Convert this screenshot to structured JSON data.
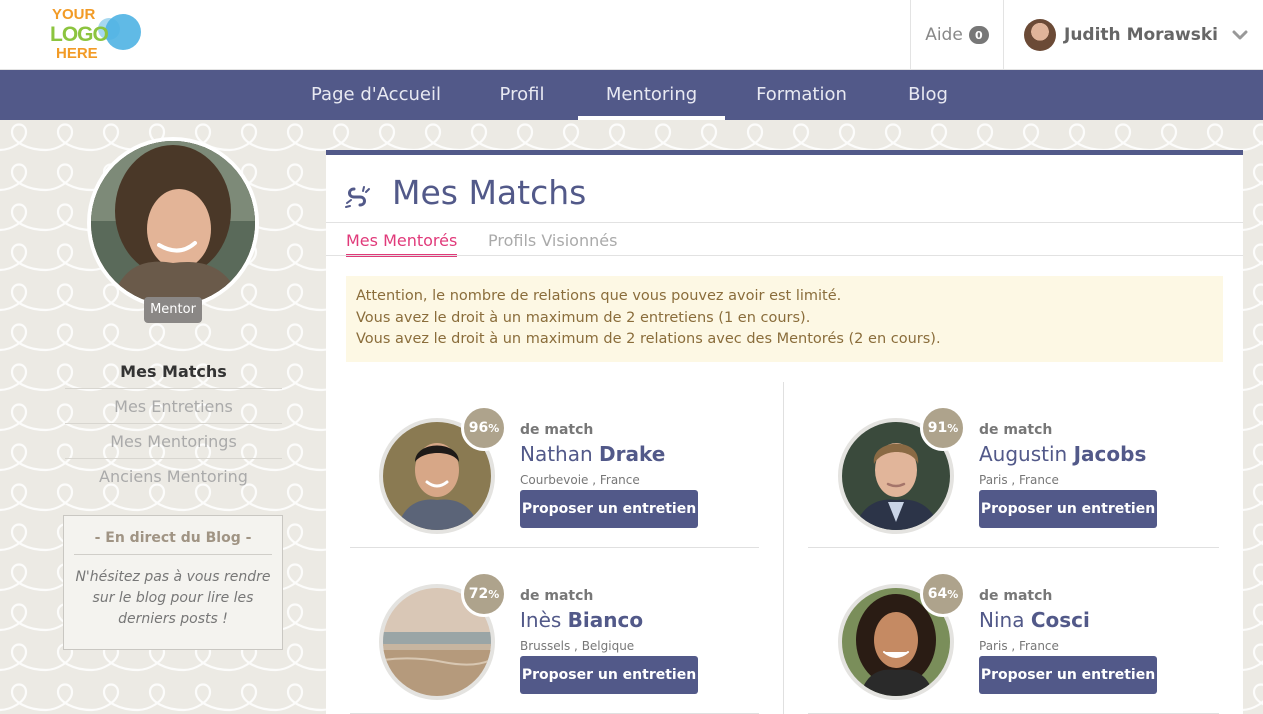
{
  "logo": {
    "line1": "YOUR",
    "line2": "LOGO",
    "line3": "HERE"
  },
  "header": {
    "help_label": "Aide",
    "help_count": "0",
    "user_name": "Judith Morawski"
  },
  "nav": {
    "items": [
      {
        "label": "Page d'Accueil"
      },
      {
        "label": "Profil"
      },
      {
        "label": "Mentoring"
      },
      {
        "label": "Formation"
      },
      {
        "label": "Blog"
      }
    ],
    "active": "Mentoring"
  },
  "sidebar": {
    "role_badge": "Mentor",
    "menu": [
      {
        "label": "Mes Matchs"
      },
      {
        "label": "Mes Entretiens"
      },
      {
        "label": "Mes Mentorings"
      },
      {
        "label": "Anciens Mentoring"
      }
    ],
    "blog": {
      "title": "- En direct du Blog -",
      "text": "N'hésitez pas à vous rendre sur le blog pour lire les derniers posts !"
    }
  },
  "main": {
    "title": "Mes Matchs",
    "tabs": [
      {
        "label": "Mes Mentorés"
      },
      {
        "label": "Profils Visionnés"
      }
    ],
    "alert": {
      "lines": [
        "Attention, le nombre de relations que vous pouvez avoir est limité.",
        "Vous avez le droit à un maximum de 2 entretiens (1 en cours).",
        "Vous avez le droit à un maximum de 2 relations avec des Mentorés (2 en cours)."
      ]
    },
    "match_label": "de match",
    "button_label": "Proposer un entretien",
    "matches": [
      {
        "percent": "96",
        "first_name": "Nathan",
        "last_name": "Drake",
        "location": "Courbevoie , France"
      },
      {
        "percent": "91",
        "first_name": "Augustin",
        "last_name": "Jacobs",
        "location": "Paris , France"
      },
      {
        "percent": "72",
        "first_name": "Inès",
        "last_name": "Bianco",
        "location": "Brussels , Belgique"
      },
      {
        "percent": "64",
        "first_name": "Nina",
        "last_name": "Cosci",
        "location": "Paris , France"
      }
    ],
    "percent_unit": "%"
  },
  "colors": {
    "brand": "#525989",
    "accent": "#e03a7a",
    "badge": "#aea38c",
    "alert_bg": "#fdf8e4"
  }
}
